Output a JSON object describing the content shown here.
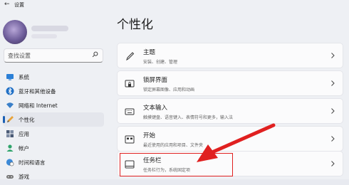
{
  "window": {
    "title": "设置",
    "back_icon": "back-arrow-icon"
  },
  "sidebar": {
    "search": {
      "placeholder": "查找设置",
      "icon": "search-icon"
    },
    "items": [
      {
        "label": "系统",
        "icon": "monitor-icon",
        "active": false
      },
      {
        "label": "蓝牙和其他设备",
        "icon": "bluetooth-icon",
        "active": false
      },
      {
        "label": "网络和 Internet",
        "icon": "wifi-icon",
        "active": false
      },
      {
        "label": "个性化",
        "icon": "pencil-icon",
        "active": true
      },
      {
        "label": "应用",
        "icon": "apps-icon",
        "active": false
      },
      {
        "label": "帐户",
        "icon": "account-icon",
        "active": false
      },
      {
        "label": "时间和语言",
        "icon": "globe-clock-icon",
        "active": false
      },
      {
        "label": "游戏",
        "icon": "gamepad-icon",
        "active": false
      }
    ]
  },
  "main": {
    "title": "个性化",
    "cards": [
      {
        "title": "主题",
        "subtitle": "安装、创建、管理",
        "icon": "brush-icon"
      },
      {
        "title": "锁屏界面",
        "subtitle": "锁定屏幕图像、应用和动画",
        "icon": "lock-screen-icon"
      },
      {
        "title": "文本输入",
        "subtitle": "触摸键盘、语音键入、表情符号和更多，输入法",
        "icon": "keyboard-icon"
      },
      {
        "title": "开始",
        "subtitle": "最近使用的应用和项目、文件夹",
        "icon": "start-icon"
      },
      {
        "title": "任务栏",
        "subtitle": "任务栏行为，系统固定项",
        "icon": "taskbar-icon"
      }
    ]
  },
  "annotation": {
    "color": "#e02020"
  }
}
